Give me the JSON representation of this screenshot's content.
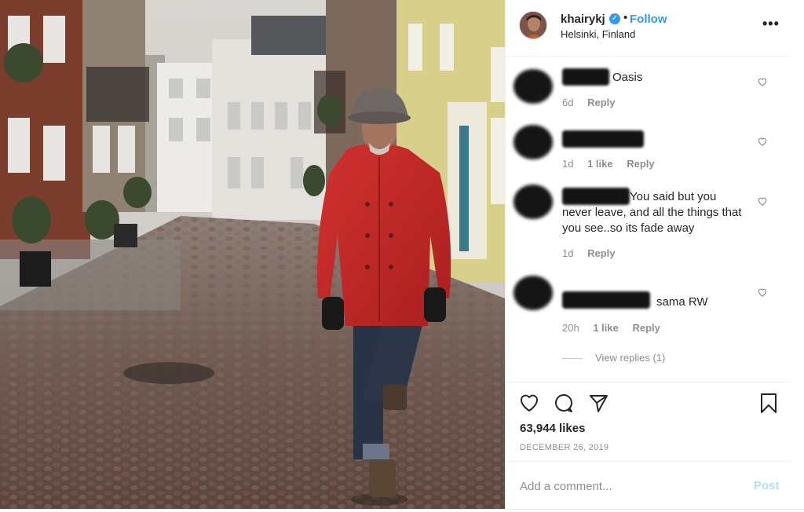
{
  "post": {
    "username": "khairykj",
    "separator": "•",
    "follow_label": "Follow",
    "location": "Helsinki, Finland",
    "more_label": "•••",
    "verified_glyph": "✓"
  },
  "comments": [
    {
      "text": "Oasis",
      "time": "6d",
      "likes": "",
      "reply": "Reply"
    },
    {
      "text": "",
      "time": "1d",
      "likes": "1 like",
      "reply": "Reply"
    },
    {
      "text": "You said but you never leave, and all the things that you see..so its fade away",
      "time": "1d",
      "likes": "",
      "reply": "Reply"
    },
    {
      "text": "sama RW",
      "time": "20h",
      "likes": "1 like",
      "reply": "Reply"
    }
  ],
  "view_replies": "View replies (1)",
  "likes_count": "63,944 likes",
  "date": "DECEMBER 26, 2019",
  "add_comment": {
    "placeholder": "Add a comment...",
    "post_label": "Post"
  },
  "icons": [
    "heart-icon",
    "comment-icon",
    "share-icon",
    "bookmark-icon",
    "verified-icon",
    "more-icon"
  ],
  "colors": {
    "link": "#3897f0",
    "post_disabled": "#b2dffc",
    "muted": "#8e8e8e",
    "coat": "#c8282b"
  }
}
